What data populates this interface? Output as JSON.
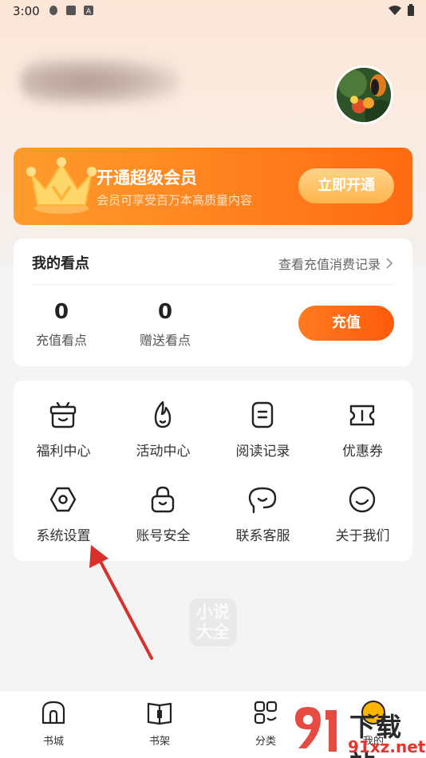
{
  "status_bar": {
    "time": "3:00"
  },
  "vip": {
    "title": "开通超级会员",
    "subtitle": "会员可享受百万本高质量内容",
    "button": "立即开通",
    "accent": "#ff8420"
  },
  "points": {
    "title": "我的看点",
    "link": "查看充值消费记录",
    "recharge_points_value": "0",
    "recharge_points_label": "充值看点",
    "gift_points_value": "0",
    "gift_points_label": "赠送看点",
    "recharge_button": "充值"
  },
  "menu": {
    "items": [
      {
        "label": "福利中心",
        "icon": "gift-basket-icon"
      },
      {
        "label": "活动中心",
        "icon": "flame-icon"
      },
      {
        "label": "阅读记录",
        "icon": "reading-record-icon"
      },
      {
        "label": "优惠券",
        "icon": "coupon-icon"
      },
      {
        "label": "系统设置",
        "icon": "settings-icon"
      },
      {
        "label": "账号安全",
        "icon": "lock-icon"
      },
      {
        "label": "联系客服",
        "icon": "customer-service-icon"
      },
      {
        "label": "关于我们",
        "icon": "smile-icon"
      }
    ]
  },
  "watermark": {
    "line1": "小说",
    "line2": "大全"
  },
  "nav": {
    "items": [
      {
        "label": "书城",
        "icon": "bookstore-icon"
      },
      {
        "label": "书架",
        "icon": "bookshelf-icon"
      },
      {
        "label": "分类",
        "icon": "category-icon"
      },
      {
        "label": "我的",
        "icon": "profile-icon"
      }
    ]
  },
  "site_watermark": {
    "big": "下载站",
    "small": "91xz.net"
  },
  "annotation": {
    "arrow_color": "#d9302a"
  }
}
